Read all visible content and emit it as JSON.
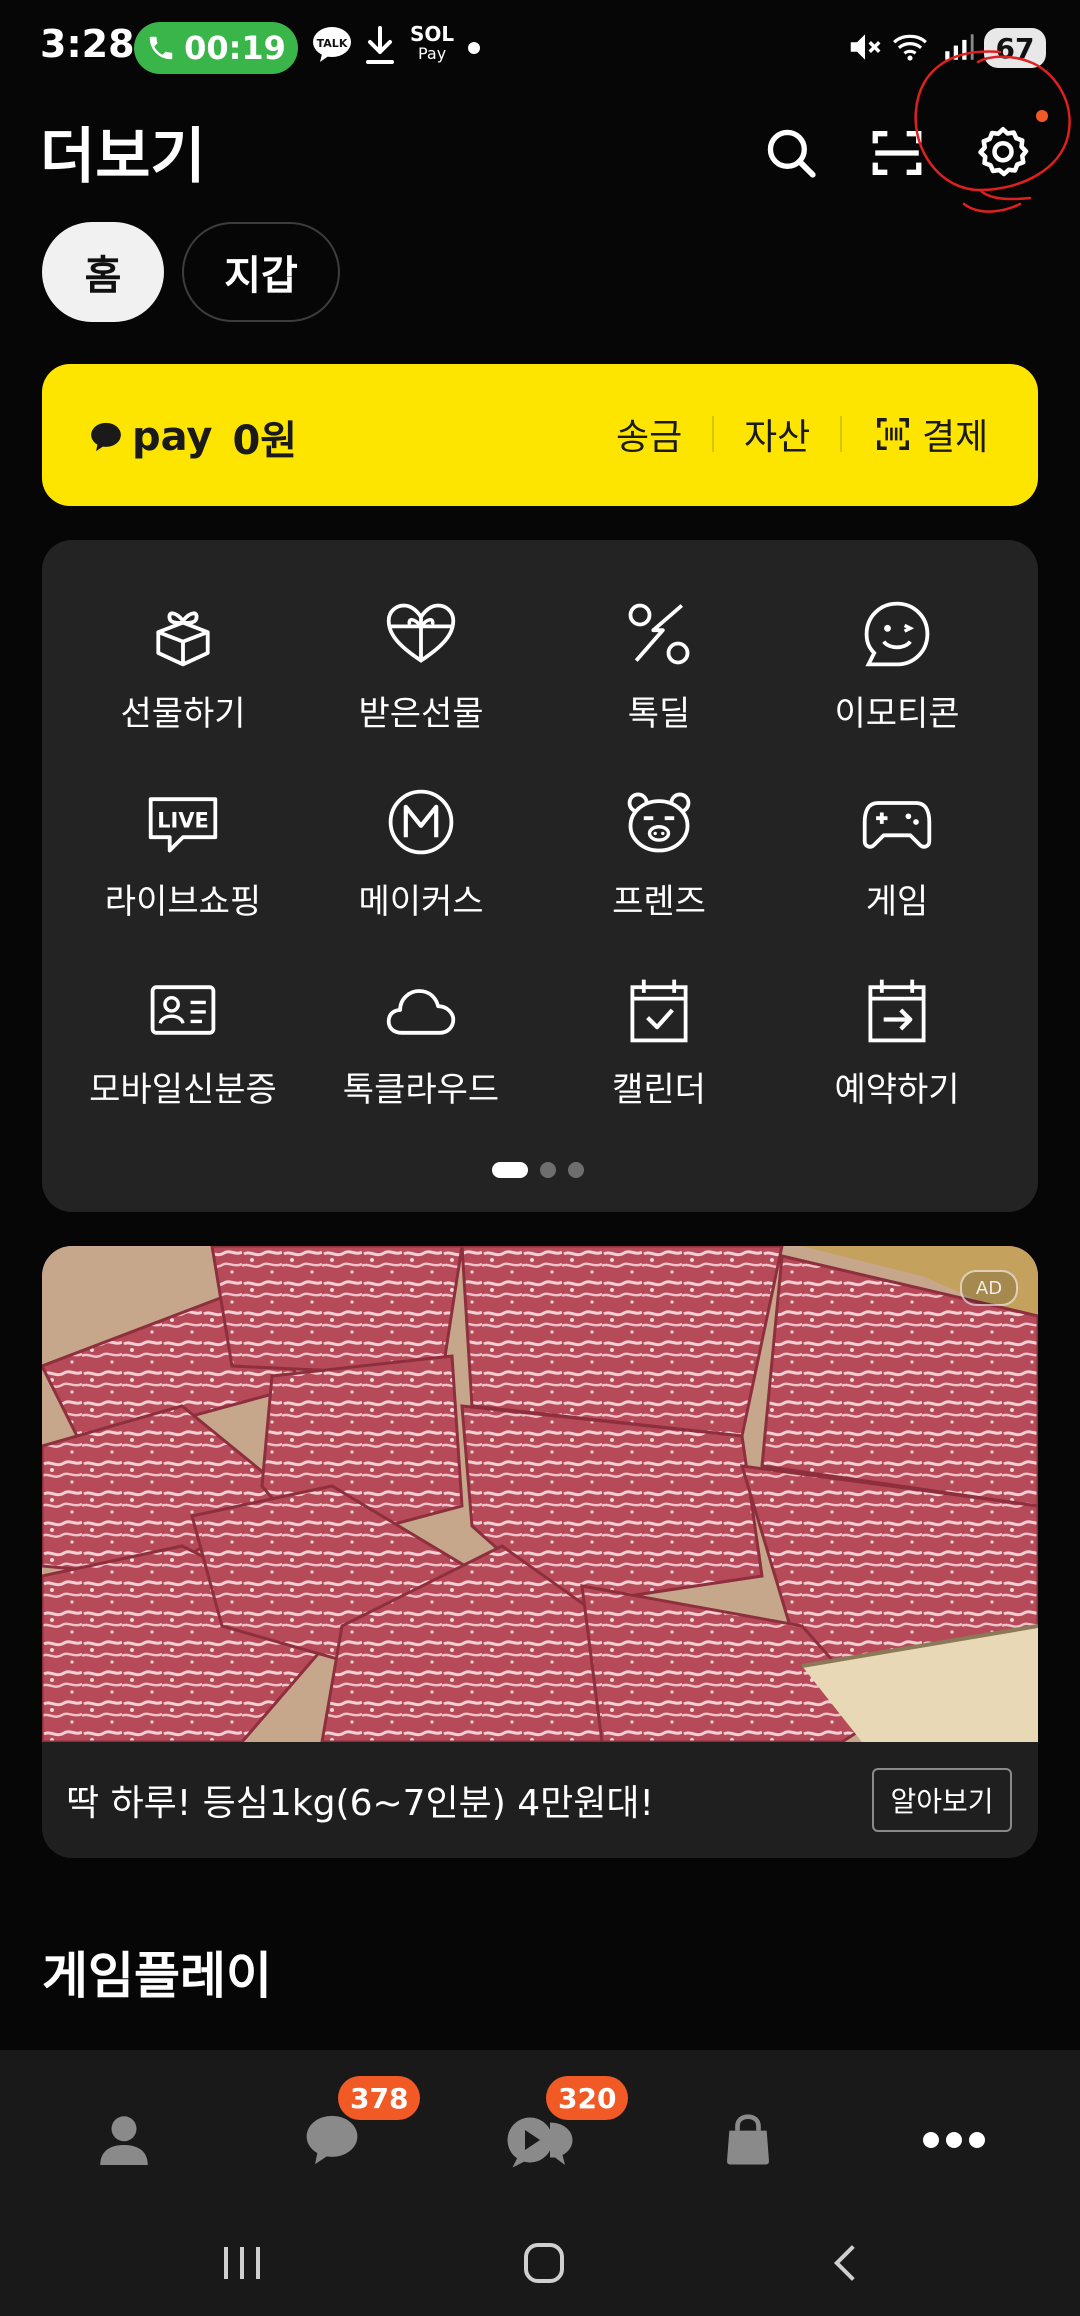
{
  "status_bar": {
    "time": "3:28",
    "call_timer": "00:19",
    "talk_label": "TALK",
    "sol_pay_top": "SOL",
    "sol_pay_bottom": "Pay",
    "battery": "67"
  },
  "header": {
    "title": "더보기"
  },
  "tabs": [
    {
      "label": "홈",
      "active": true
    },
    {
      "label": "지갑",
      "active": false
    }
  ],
  "pay_banner": {
    "brand": "pay",
    "balance": "0원",
    "links": [
      "송금",
      "자산",
      "결제"
    ]
  },
  "services": [
    {
      "label": "선물하기",
      "icon": "gift-box-icon"
    },
    {
      "label": "받은선물",
      "icon": "heart-gift-icon"
    },
    {
      "label": "톡딜",
      "icon": "percent-deal-icon"
    },
    {
      "label": "이모티콘",
      "icon": "smiley-icon"
    },
    {
      "label": "라이브쇼핑",
      "icon": "live-bubble-icon",
      "icon_text": "LIVE"
    },
    {
      "label": "메이커스",
      "icon": "makers-icon",
      "icon_text": "M"
    },
    {
      "label": "프렌즈",
      "icon": "friends-bear-icon"
    },
    {
      "label": "게임",
      "icon": "gamepad-icon"
    },
    {
      "label": "모바일신분증",
      "icon": "id-card-icon"
    },
    {
      "label": "톡클라우드",
      "icon": "cloud-icon"
    },
    {
      "label": "캘린더",
      "icon": "calendar-check-icon"
    },
    {
      "label": "예약하기",
      "icon": "calendar-arrow-icon"
    }
  ],
  "pager": {
    "pages": 3,
    "current": 1
  },
  "ad": {
    "badge": "AD",
    "text": "딱 하루! 등심1kg(6~7인분) 4만원대!",
    "button": "알아보기"
  },
  "section": {
    "title": "게임플레이"
  },
  "bottom_nav": {
    "items": [
      {
        "icon": "person-icon"
      },
      {
        "icon": "chat-bubble-icon",
        "badge": "378"
      },
      {
        "icon": "open-chat-icon",
        "badge": "320"
      },
      {
        "icon": "shopping-bag-icon"
      },
      {
        "icon": "more-dots-icon"
      }
    ]
  },
  "colors": {
    "background": "#060606",
    "pay_yellow": "#fee500",
    "badge_orange": "#f15a24",
    "call_green": "#39b54a",
    "annotation_red": "#e0201e"
  }
}
